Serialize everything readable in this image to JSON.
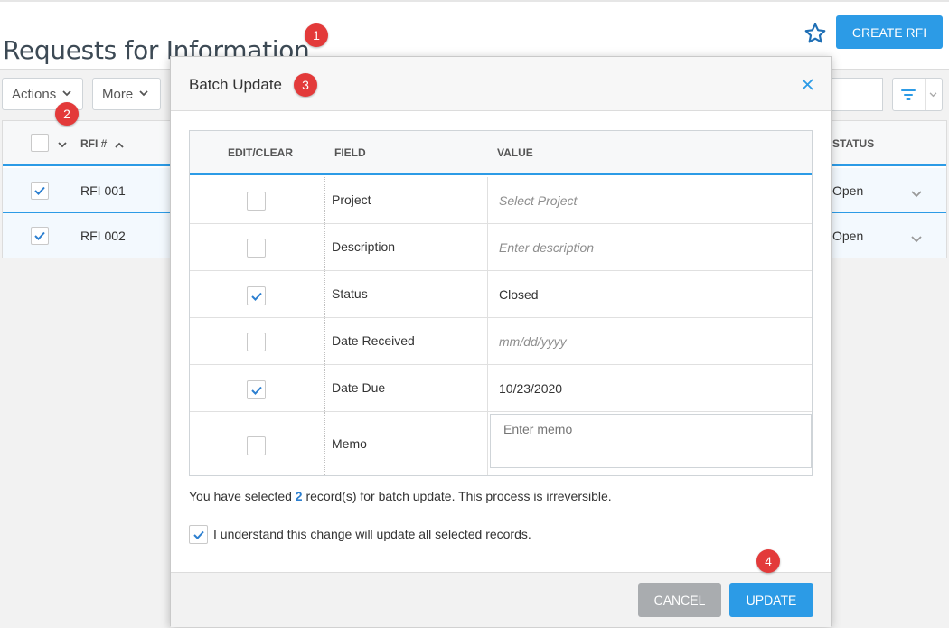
{
  "page": {
    "title": "Requests for Information",
    "create_button": "CREATE RFI"
  },
  "toolbar": {
    "actions_label": "Actions",
    "more_label": "More"
  },
  "grid": {
    "col_rfi": "RFI #",
    "col_status": "STATUS",
    "rows": [
      {
        "rfi": "RFI 001",
        "status": "Open"
      },
      {
        "rfi": "RFI 002",
        "status": "Open"
      }
    ]
  },
  "modal": {
    "title": "Batch Update",
    "columns": {
      "edit_clear": "EDIT/CLEAR",
      "field": "FIELD",
      "value": "VALUE"
    },
    "rows": [
      {
        "field": "Project",
        "value": "Select Project",
        "checked": false,
        "placeholder": true
      },
      {
        "field": "Description",
        "value": "Enter description",
        "checked": false,
        "placeholder": true
      },
      {
        "field": "Status",
        "value": "Closed",
        "checked": true,
        "placeholder": false
      },
      {
        "field": "Date Received",
        "value": "mm/dd/yyyy",
        "checked": false,
        "placeholder": true
      },
      {
        "field": "Date Due",
        "value": "10/23/2020",
        "checked": true,
        "placeholder": false
      },
      {
        "field": "Memo",
        "value": "Enter memo",
        "checked": false,
        "placeholder": true
      }
    ],
    "selected_prefix": "You have selected ",
    "selected_count": "2",
    "selected_suffix": " record(s) for batch update. This process is irreversible.",
    "acknowledge": "I understand this change will update all selected records.",
    "cancel_label": "CANCEL",
    "update_label": "UPDATE"
  },
  "badges": [
    "1",
    "2",
    "3",
    "4"
  ],
  "colors": {
    "accent": "#2c9be6",
    "badge": "#e33a3a",
    "cancel": "#a9acaf",
    "title_text": "#3d4a55"
  },
  "icons": [
    "star-icon",
    "chevron-down-icon",
    "chevron-up-icon",
    "check-icon",
    "close-icon",
    "filter-icon"
  ]
}
